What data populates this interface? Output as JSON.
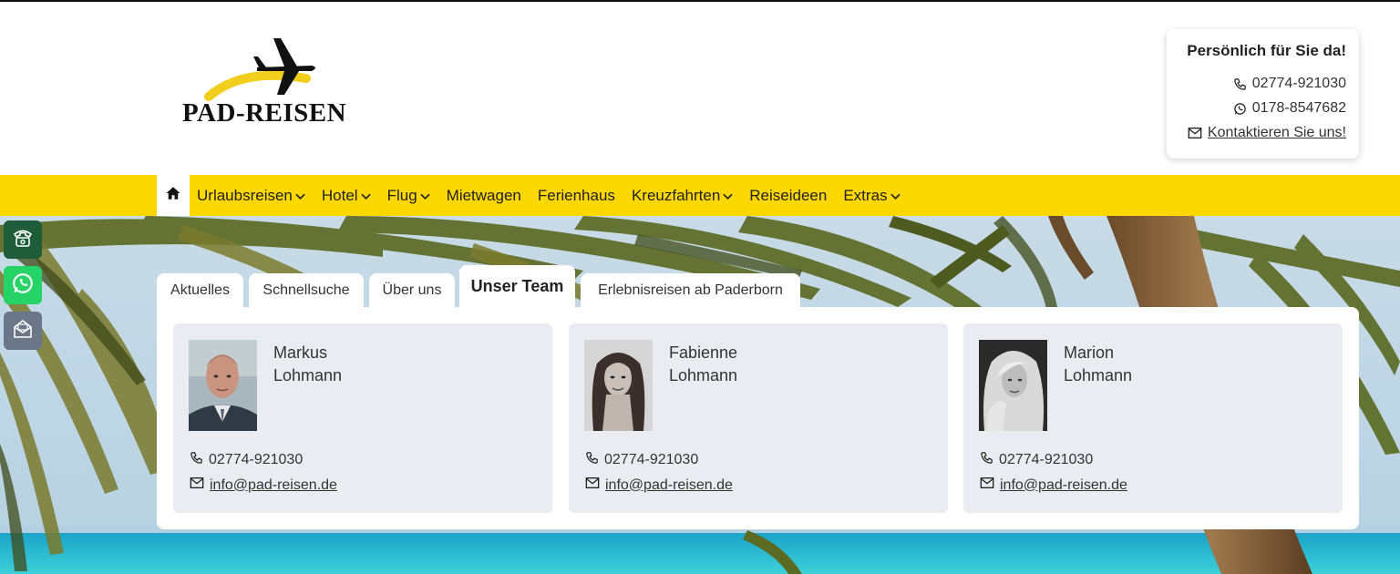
{
  "brand": {
    "name": "PAD-REISEN",
    "accent": "#fcd700"
  },
  "contact": {
    "title": "Persönlich für Sie da!",
    "phone": "02774-921030",
    "whatsapp": "0178-8547682",
    "contact_link": "Kontaktieren Sie uns!"
  },
  "nav": {
    "items": [
      {
        "label": "Urlaubsreisen",
        "dropdown": true
      },
      {
        "label": "Hotel",
        "dropdown": true
      },
      {
        "label": "Flug",
        "dropdown": true
      },
      {
        "label": "Mietwagen",
        "dropdown": false
      },
      {
        "label": "Ferienhaus",
        "dropdown": false
      },
      {
        "label": "Kreuzfahrten",
        "dropdown": true
      },
      {
        "label": "Reiseideen",
        "dropdown": false
      },
      {
        "label": "Extras",
        "dropdown": true
      }
    ]
  },
  "tabs": [
    {
      "label": "Aktuelles",
      "active": false
    },
    {
      "label": "Schnellsuche",
      "active": false
    },
    {
      "label": "Über uns",
      "active": false
    },
    {
      "label": "Unser Team",
      "active": true
    },
    {
      "label": "Erlebnisreisen ab Paderborn",
      "active": false
    }
  ],
  "team": [
    {
      "first": "Markus",
      "last": "Lohmann",
      "phone": "02774-921030",
      "email": "info@pad-reisen.de"
    },
    {
      "first": "Fabienne",
      "last": "Lohmann",
      "phone": "02774-921030",
      "email": "info@pad-reisen.de"
    },
    {
      "first": "Marion",
      "last": "Lohmann",
      "phone": "02774-921030",
      "email": "info@pad-reisen.de"
    }
  ],
  "side_buttons": [
    {
      "icon": "phone-icon",
      "color": "#1e5c3a"
    },
    {
      "icon": "whatsapp-icon",
      "color": "#25d366"
    },
    {
      "icon": "mail-open-icon",
      "color": "#6b7688"
    }
  ]
}
